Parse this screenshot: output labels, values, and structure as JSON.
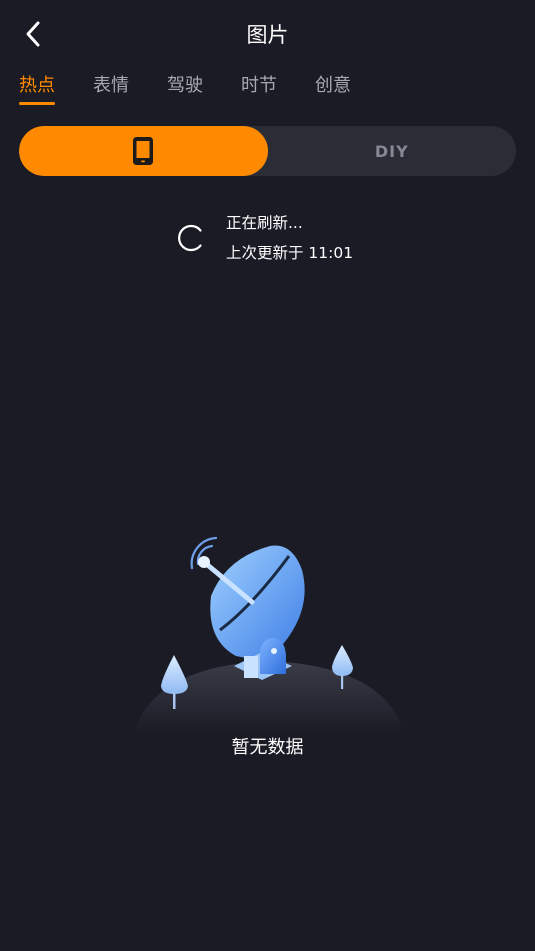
{
  "header": {
    "title": "图片",
    "back_icon": "chevron-left-icon"
  },
  "tabs": [
    {
      "label": "热点",
      "active": true
    },
    {
      "label": "表情",
      "active": false
    },
    {
      "label": "驾驶",
      "active": false
    },
    {
      "label": "时节",
      "active": false
    },
    {
      "label": "创意",
      "active": false
    }
  ],
  "segment": {
    "left_icon": "phone-icon",
    "right_label": "DIY",
    "active_index": 0
  },
  "refresh": {
    "status": "正在刷新...",
    "last_updated": "上次更新于 11:01"
  },
  "empty": {
    "illustration": "satellite-dish-icon",
    "message": "暂无数据"
  },
  "colors": {
    "background": "#1a1b25",
    "accent": "#ff8a00",
    "segment_bg": "#2a2c36",
    "tab_inactive": "#a7a8b0"
  }
}
